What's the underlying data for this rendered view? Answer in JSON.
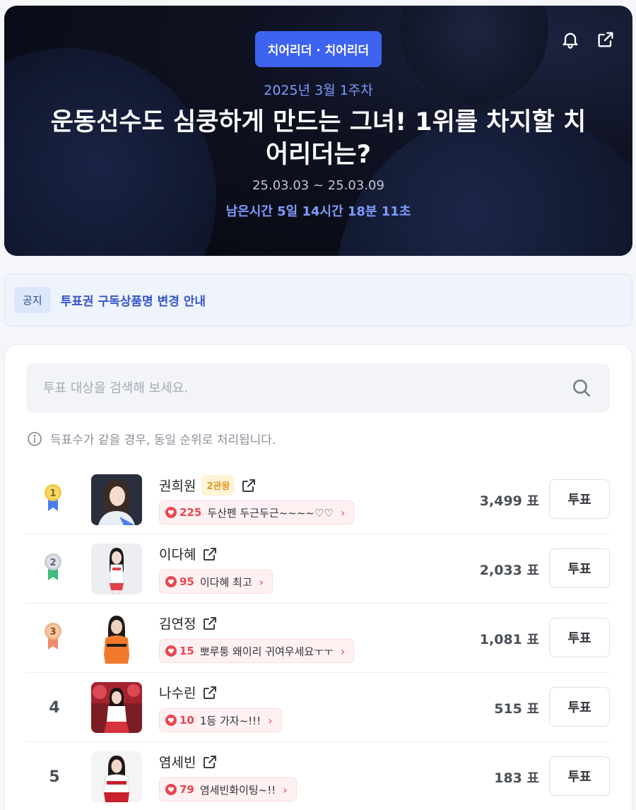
{
  "hero": {
    "category": "치어리더 · 치어리더",
    "week": "2025년 3월 1주차",
    "title": "운동선수도 심쿵하게 만드는 그녀! 1위를 차지할 치어리더는?",
    "period": "25.03.03 ~ 25.03.09",
    "remaining": "남은시간 5일 14시간 18분 11초",
    "icons": [
      "bell-icon",
      "share-icon"
    ]
  },
  "notice": {
    "tag": "공지",
    "text": "투표권 구독상품명 변경 안내"
  },
  "search": {
    "placeholder": "투표 대상을 검색해 보세요.",
    "icon": "search-icon"
  },
  "info": {
    "text": "득표수가 같을 경우, 동일 순위로 처리됩니다.",
    "icon": "info-icon"
  },
  "vote_label": "투표",
  "ranking": [
    {
      "rank": "1",
      "name": "권희원",
      "badge": "2관왕",
      "comment_count": "225",
      "comment": "두산펜 두근두근~~~~♡♡",
      "votes": "3,499 표",
      "medal_color": "#f2c94c"
    },
    {
      "rank": "2",
      "name": "이다혜",
      "badge": "",
      "comment_count": "95",
      "comment": "이다혜 최고",
      "votes": "2,033 표",
      "medal_color": "#c9ced6"
    },
    {
      "rank": "3",
      "name": "김연정",
      "badge": "",
      "comment_count": "15",
      "comment": "뽀루퉁 왜이리 귀여우세요ㅜㅜ",
      "votes": "1,081 표",
      "medal_color": "#f0b48a"
    },
    {
      "rank": "4",
      "name": "나수린",
      "badge": "",
      "comment_count": "10",
      "comment": "1등 가자~!!!",
      "votes": "515 표"
    },
    {
      "rank": "5",
      "name": "염세빈",
      "badge": "",
      "comment_count": "79",
      "comment": "염세빈화이팅~!!",
      "votes": "183 표"
    }
  ],
  "colors": {
    "accent": "#3d63f0",
    "heart": "#e8464f",
    "ribbon_blue": "#4d7df2",
    "ribbon_green": "#3dbb7a",
    "ribbon_orange": "#ef8a6a"
  }
}
